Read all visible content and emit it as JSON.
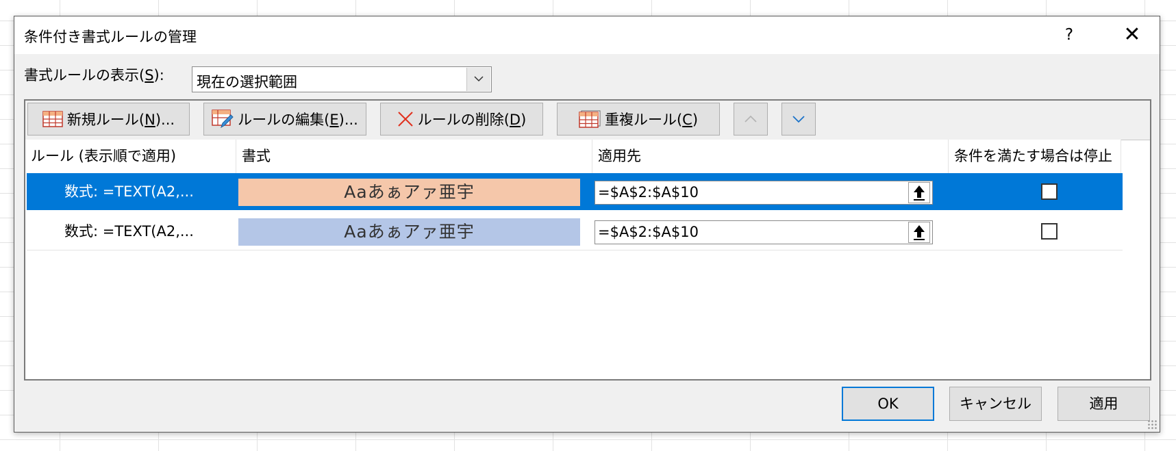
{
  "dialog": {
    "title": "条件付き書式ルールの管理",
    "help": "?",
    "close": "✕"
  },
  "show_rules": {
    "label_pre": "書式ルールの表示(",
    "label_key": "S",
    "label_post": "):",
    "value": "現在の選択範囲"
  },
  "toolbar": {
    "new_rule": {
      "pre": "新規ルール(",
      "key": "N",
      "post": ")..."
    },
    "edit_rule": {
      "pre": "ルールの編集(",
      "key": "E",
      "post": ")..."
    },
    "delete_rule": {
      "pre": "ルールの削除(",
      "key": "D",
      "post": ")"
    },
    "duplicate_rule": {
      "pre": "重複ルール(",
      "key": "C",
      "post": ")"
    }
  },
  "table": {
    "headers": {
      "rule": "ルール (表示順で適用)",
      "format": "書式",
      "applies_to": "適用先",
      "stop_if_true": "条件を満たす場合は停止"
    },
    "rows": [
      {
        "rule": "数式: =TEXT(A2,...",
        "preview": "Aaあぁアァ亜宇",
        "preview_color": "#f5c7aa",
        "applies_to": "=$A$2:$A$10",
        "stop": false,
        "selected": true
      },
      {
        "rule": "数式: =TEXT(A2,...",
        "preview": "Aaあぁアァ亜宇",
        "preview_color": "#b4c6e7",
        "applies_to": "=$A$2:$A$10",
        "stop": false,
        "selected": false
      }
    ]
  },
  "buttons": {
    "ok": "OK",
    "cancel": "キャンセル",
    "apply": "適用"
  },
  "colors": {
    "selection": "#0078d7",
    "button_face": "#e1e1e1"
  }
}
